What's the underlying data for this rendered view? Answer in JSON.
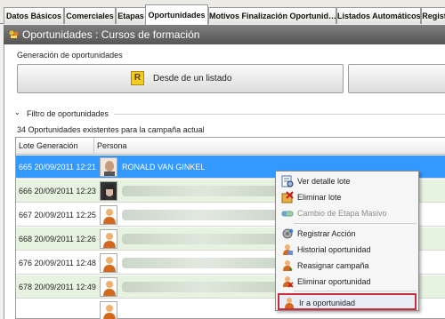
{
  "tabs": [
    {
      "label": "Datos Básicos",
      "active": false
    },
    {
      "label": "Comerciales",
      "active": false
    },
    {
      "label": "Etapas",
      "active": false
    },
    {
      "label": "Oportunidades",
      "active": true
    },
    {
      "label": "Motivos Finalización Oportunid…",
      "active": false
    },
    {
      "label": "Listados Automáticos",
      "active": false
    },
    {
      "label": "Regist",
      "active": false
    }
  ],
  "window": {
    "title": "Oportunidades : Cursos de formación"
  },
  "generation": {
    "section_label": "Generación de oportunidades",
    "from_list_button": "Desde de un listado"
  },
  "filter": {
    "label": "Filtro de oportunidades"
  },
  "count_text": "34 Oportunidades existentes para la campaña actual",
  "grid": {
    "columns": [
      "Lote Generación",
      "Persona"
    ],
    "rows": [
      {
        "lote": "665 20/09/2011 12:21",
        "persona": "RONALD VAN GINKEL",
        "selected": true
      },
      {
        "lote": "666 20/09/2011 12:23",
        "persona": "",
        "selected": false
      },
      {
        "lote": "667 20/09/2011 12:25",
        "persona": "",
        "selected": false
      },
      {
        "lote": "668 20/09/2011 12:26",
        "persona": "",
        "selected": false
      },
      {
        "lote": "676 20/09/2011 12:48",
        "persona": "",
        "selected": false
      },
      {
        "lote": "678 20/09/2011 12:49",
        "persona": "",
        "selected": false
      },
      {
        "lote": "",
        "persona": "",
        "selected": false
      }
    ]
  },
  "context_menu": {
    "items": [
      {
        "label": "Ver detalle lote",
        "icon": "detail-icon",
        "enabled": true
      },
      {
        "label": "Eliminar lote",
        "icon": "delete-lot-icon",
        "enabled": true
      },
      {
        "label": "Cambio de Etapa Masivo",
        "icon": "stage-change-icon",
        "enabled": false
      },
      {
        "label": "Registrar Acción",
        "icon": "register-action-icon",
        "enabled": true
      },
      {
        "label": "Historial oportunidad",
        "icon": "history-icon",
        "enabled": true
      },
      {
        "label": "Reasignar campaña",
        "icon": "reassign-icon",
        "enabled": true
      },
      {
        "label": "Eliminar oportunidad",
        "icon": "delete-opportunity-icon",
        "enabled": true
      },
      {
        "label": "Ir a oportunidad",
        "icon": "goto-opportunity-icon",
        "enabled": true,
        "highlighted": true
      }
    ]
  },
  "colors": {
    "selection": "#3399ff",
    "row_alt": "#e6f3e1",
    "highlight_border": "#cc2d3d"
  }
}
